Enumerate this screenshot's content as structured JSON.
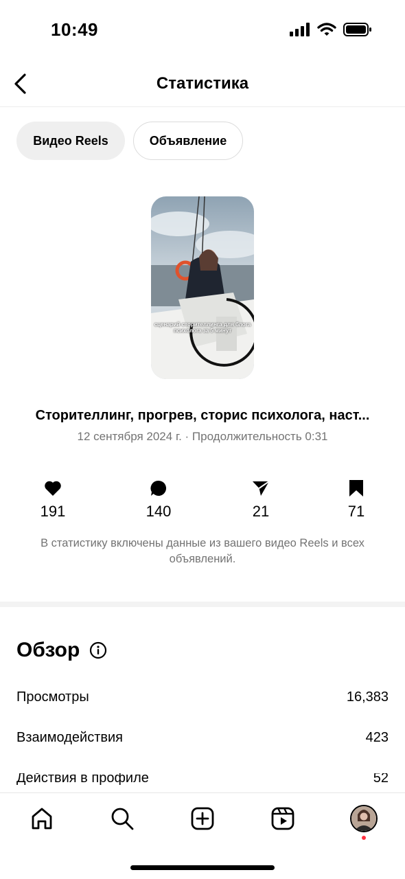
{
  "status_bar": {
    "time": "10:49"
  },
  "header": {
    "title": "Статистика"
  },
  "filters": {
    "reels": "Видео Reels",
    "ads": "Объявление"
  },
  "reel": {
    "thumbnail_caption": "сценарий сторителлинга для блога психолога за 5 минут",
    "title": "Сторителлинг, прогрев, сторис психолога, наст...",
    "subtitle": "12 сентября 2024 г. · Продолжительность 0:31"
  },
  "metrics": {
    "likes": "191",
    "comments": "140",
    "shares": "21",
    "saves": "71"
  },
  "note": "В статистику включены данные из вашего видео Reels и всех объявлений.",
  "overview": {
    "title": "Обзор",
    "rows": [
      {
        "label": "Просмотры",
        "value": "16,383"
      },
      {
        "label": "Взаимодействия",
        "value": "423"
      },
      {
        "label": "Действия в профиле",
        "value": "52"
      }
    ]
  },
  "icons": {
    "like": "heart-icon",
    "comment": "comment-icon",
    "share": "paper-plane-icon",
    "save": "bookmark-icon",
    "info": "info-icon"
  },
  "colors": {
    "notification_dot": "#ff3040",
    "secondary_text": "#737373"
  }
}
